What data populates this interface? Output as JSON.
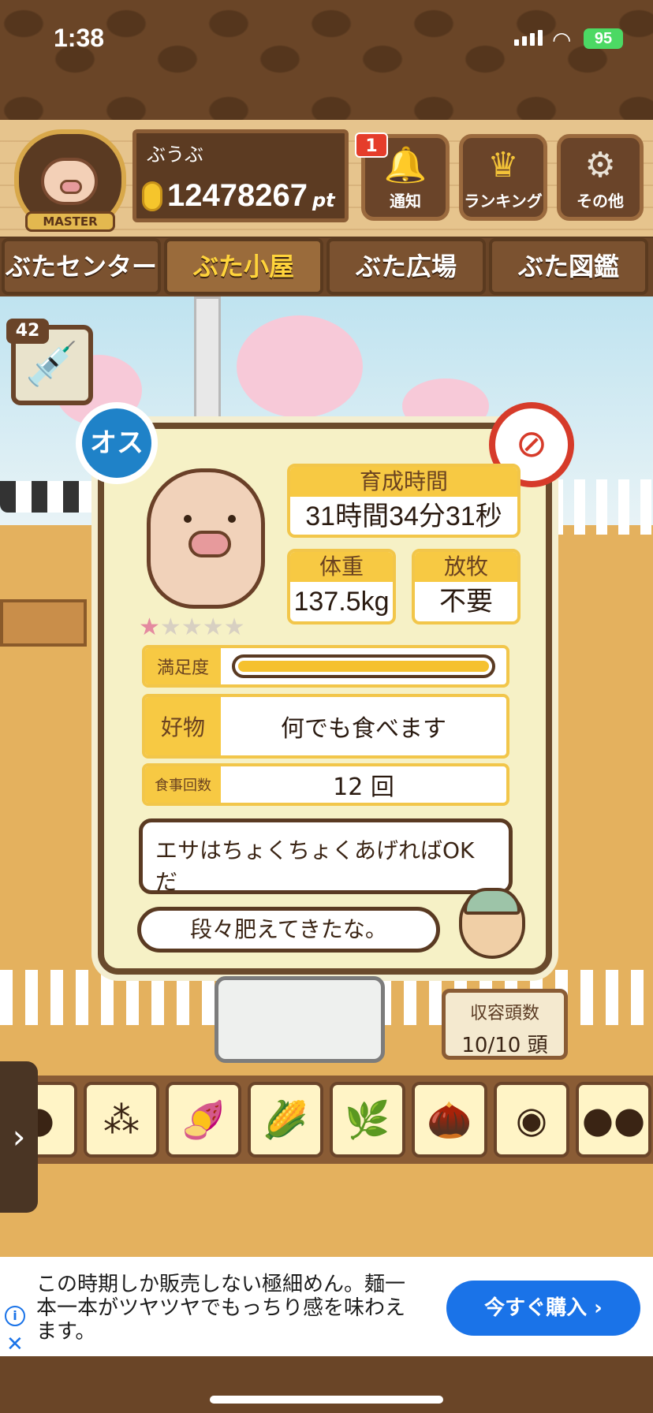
{
  "status": {
    "time": "1:38",
    "battery": "95"
  },
  "header": {
    "master_label": "MASTER",
    "username": "ぶうぶ",
    "points": "12478267",
    "points_unit": "pt",
    "notification_count": "1",
    "buttons": {
      "notify": "通知",
      "ranking": "ランキング",
      "other": "その他"
    }
  },
  "tabs": [
    "ぶたセンター",
    "ぶた小屋",
    "ぶた広場",
    "ぶた図鑑"
  ],
  "active_tab": "ぶた小屋",
  "syringe_count": "42",
  "pig": {
    "gender_label": "オス",
    "stars": 1,
    "stars_max": 5,
    "growth_label": "育成時間",
    "growth_time": "31時間34分31秒",
    "weight_label": "体重",
    "weight": "137.5kg",
    "grazing_label": "放牧",
    "grazing": "不要",
    "satisfaction_label": "満足度",
    "satisfaction_level": 1.0,
    "favorite_label": "好物",
    "favorite": "何でも食べます",
    "meals_label": "食事回数",
    "meals": "12 回",
    "speech1": "エサはちょくちょくあげればOKだ",
    "speech2": "段々肥えてきたな。"
  },
  "capacity": {
    "label": "収容頭数",
    "value": "10/10 頭"
  },
  "feeds": [
    "soybeans",
    "grains",
    "sweet-potato",
    "corn",
    "nuts",
    "acorns",
    "beans-plate",
    "truffles"
  ],
  "ad": {
    "text": "この時期しか販売しない極細めん。麺一本一本がツヤツヤでもっちり感を味わえます。",
    "button": "今すぐ購入 ›"
  },
  "colors": {
    "accent_yellow": "#f7c943",
    "male_blue": "#1f82c8",
    "ad_blue": "#1a73e8"
  }
}
